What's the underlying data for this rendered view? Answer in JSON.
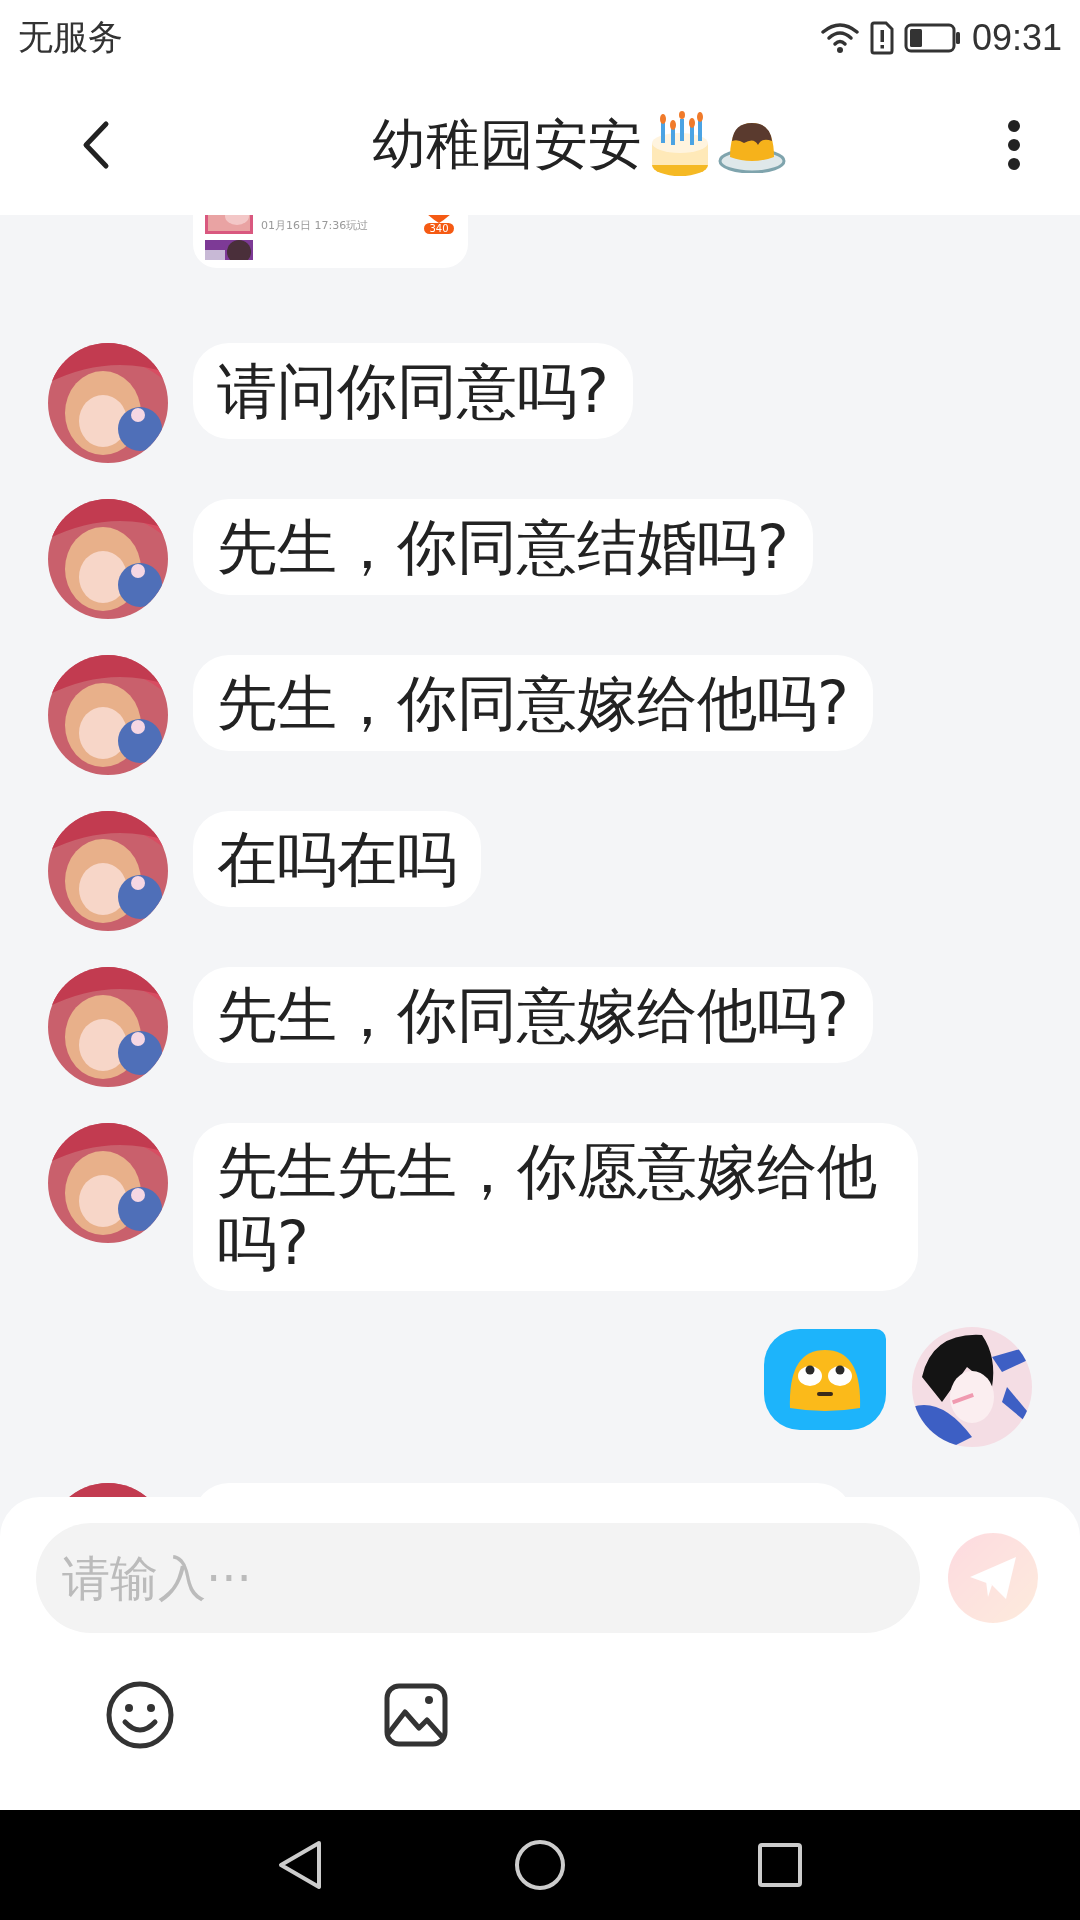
{
  "status_bar": {
    "carrier": "无服务",
    "time": "09:31"
  },
  "header": {
    "title": "幼稚园安安"
  },
  "shared_card": {
    "caption": "01月16日 17:36玩过",
    "badge": "340"
  },
  "messages": [
    {
      "kind": "text",
      "outgoing": false,
      "text": "请问你同意吗?"
    },
    {
      "kind": "text",
      "outgoing": false,
      "text": "先生，你同意结婚吗?"
    },
    {
      "kind": "text",
      "outgoing": false,
      "text": "先生，你同意嫁给他吗?"
    },
    {
      "kind": "text",
      "outgoing": false,
      "text": "在吗在吗"
    },
    {
      "kind": "text",
      "outgoing": false,
      "text": "先生，你同意嫁给他吗?"
    },
    {
      "kind": "text",
      "outgoing": false,
      "text": "先生先生，你愿意嫁给他吗?"
    },
    {
      "kind": "sticker",
      "outgoing": true
    },
    {
      "kind": "partial",
      "outgoing": false
    }
  ],
  "composer": {
    "placeholder": "请输入···",
    "send_disabled": true
  }
}
